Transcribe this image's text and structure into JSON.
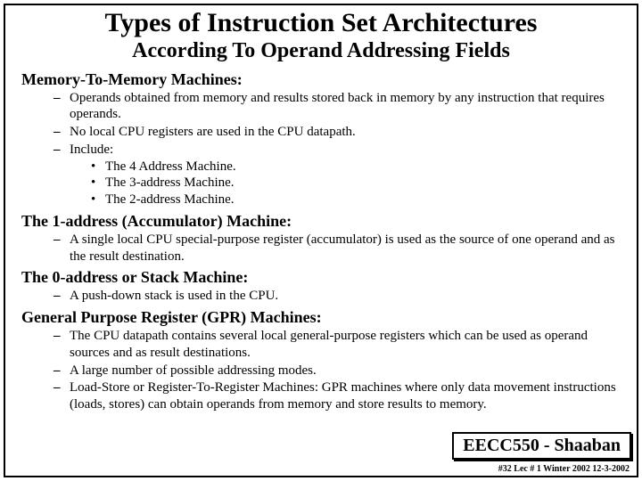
{
  "title": "Types of Instruction Set Architectures",
  "subtitle": "According To Operand Addressing Fields",
  "sections": [
    {
      "heading": "Memory-To-Memory Machines:",
      "bullets": [
        {
          "text": "Operands obtained from memory and results stored back in memory by any instruction that requires operands."
        },
        {
          "text": "No local CPU registers are used in the CPU datapath."
        },
        {
          "text": "Include:",
          "sub": [
            "The 4 Address Machine.",
            "The 3-address Machine.",
            "The 2-address Machine."
          ]
        }
      ]
    },
    {
      "heading": "The 1-address (Accumulator) Machine:",
      "bullets": [
        {
          "text": "A single local CPU special-purpose register (accumulator) is used as the source of one operand and as the result destination."
        }
      ]
    },
    {
      "heading": "The 0-address or Stack Machine:",
      "bullets": [
        {
          "text": "A push-down stack is used in the CPU."
        }
      ]
    },
    {
      "heading": "General Purpose Register (GPR) Machines:",
      "bullets": [
        {
          "text": "The CPU datapath contains several local general-purpose registers which can be used as operand sources and as result destinations."
        },
        {
          "text": "A large number of possible addressing modes."
        },
        {
          "text": "Load-Store or Register-To-Register Machines:  GPR machines where only data movement instructions (loads, stores) can obtain operands from memory and store results to memory."
        }
      ]
    }
  ],
  "footer": {
    "course": "EECC550 - Shaaban",
    "meta": "#32   Lec # 1 Winter 2002  12-3-2002"
  }
}
